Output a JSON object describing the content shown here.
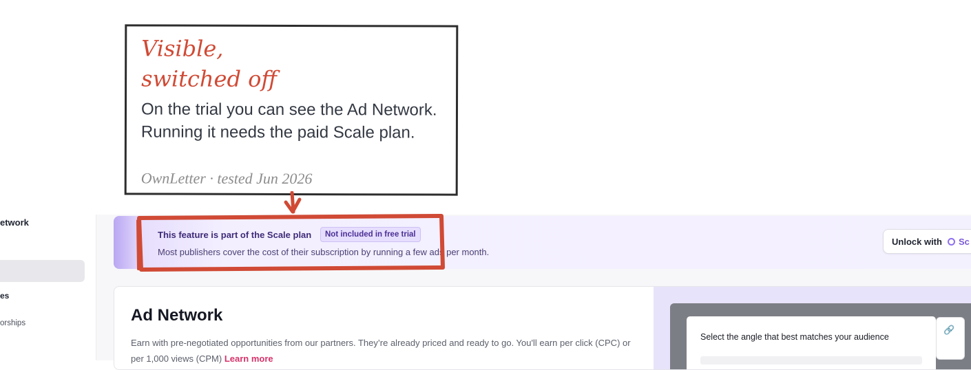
{
  "sidebar": {
    "title": "etwork",
    "group": "es",
    "sub_item": "orships"
  },
  "banner": {
    "title": "This feature is part of the Scale plan",
    "badge": "Not included in free trial",
    "description": "Most publishers cover the cost of their subscription by running a few ads per month.",
    "unlock_label": "Unlock with",
    "unlock_plan": "Sc"
  },
  "card": {
    "title": "Ad Network",
    "description": "Earn with pre-negotiated opportunities from our partners. They’re already priced and ready to go. You'll earn per click (CPC) or per 1,000 views (CPM)",
    "learn_more": "Learn more"
  },
  "preview": {
    "question": "Select the angle that best matches your audience"
  },
  "annotation": {
    "headline_line1": "Visible,",
    "headline_line2": "switched off",
    "body": "On the trial you can see the Ad Network. Running it needs the paid Scale plan.",
    "source": "OwnLetter · tested Jun 2026"
  },
  "colors": {
    "annotation_accent": "#d04a35",
    "banner_purple": "#3e2a77",
    "learn_more": "#d6336c"
  }
}
